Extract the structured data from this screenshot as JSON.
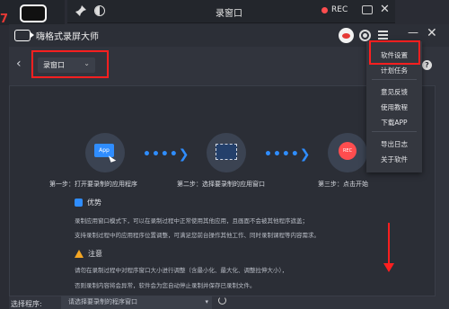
{
  "mini_toolbar": {
    "title": "录窗口",
    "rec_label": "REC"
  },
  "app": {
    "title": "嗨格式录屏大师"
  },
  "mode_select": {
    "value": "录窗口"
  },
  "steps": [
    {
      "label": "第一步：打开要录制的应用程序"
    },
    {
      "label": "第二步：选择要录制的应用窗口"
    },
    {
      "label": "第三步：点击开始"
    }
  ],
  "advantages": {
    "title": "优势",
    "lines": [
      "录制应用窗口模式下，可以在录制过程中正常使用其他应用，且画面不会被其他程序遮盖；",
      "支持录制过程中的应用程序位置调整，可满足您前台操作其他工作、同时录制课程等内容需求。"
    ]
  },
  "notice": {
    "title": "注意",
    "lines": [
      "请勿在录制过程中对程序窗口大小进行调整（含最小化、最大化、调整拉伸大小），",
      "否则录制内容将会异常，软件会为您自动停止录制并保存已录制文件。"
    ]
  },
  "bottom": {
    "label": "选择程序:",
    "select_value": "请选择要录制的程序窗口"
  },
  "menu": {
    "items": [
      "软件设置",
      "计划任务",
      "意见反馈",
      "使用教程",
      "下载APP",
      "导出日志",
      "关于软件"
    ]
  },
  "colors": {
    "accent": "#2f8dff",
    "annotation": "#ff1f1f",
    "rec": "#ff4d4f"
  }
}
